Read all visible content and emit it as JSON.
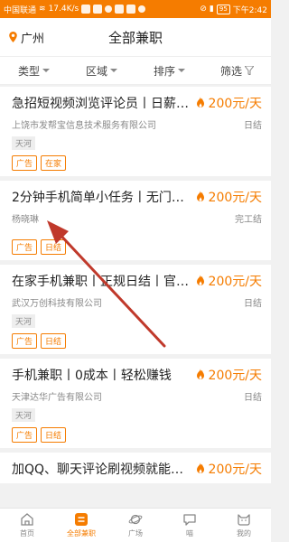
{
  "statusbar": {
    "carrier": "中国联通",
    "speed": "17.4K/s",
    "battery": "95",
    "time": "下午2:42"
  },
  "header": {
    "city": "广州",
    "title": "全部兼职"
  },
  "filters": [
    {
      "label": "类型"
    },
    {
      "label": "区域"
    },
    {
      "label": "排序"
    },
    {
      "label": "筛选"
    }
  ],
  "jobs": [
    {
      "title": "急招短视频浏览评论员丨日薪20...",
      "price": "200元/天",
      "company": "上饶市发帮宝信息技术服务有限公司",
      "settle": "日结",
      "location": "天河",
      "tags": [
        "广告",
        "在家"
      ]
    },
    {
      "title": "2分钟手机简单小任务丨无门槛...",
      "price": "200元/天",
      "company": "杨晓琳",
      "settle": "完工结",
      "location": "",
      "tags": [
        "广告",
        "日结"
      ]
    },
    {
      "title": "在家手机兼职丨正规日结丨官方...",
      "price": "200元/天",
      "company": "武汉万创科技有限公司",
      "settle": "日结",
      "location": "天河",
      "tags": [
        "广告",
        "日结"
      ]
    },
    {
      "title": "手机兼职丨0成本丨轻松赚钱",
      "price": "200元/天",
      "company": "天津达华广告有限公司",
      "settle": "日结",
      "location": "天河",
      "tags": [
        "广告",
        "日结"
      ]
    },
    {
      "title": "加QQ、聊天评论刷视频就能挣...",
      "price": "200元/天",
      "company": "",
      "settle": "",
      "location": "",
      "tags": []
    }
  ],
  "tabs": [
    {
      "label": "首页",
      "icon": "home-icon"
    },
    {
      "label": "全部兼职",
      "icon": "list-icon",
      "active": true
    },
    {
      "label": "广场",
      "icon": "planet-icon"
    },
    {
      "label": "喵",
      "icon": "chat-icon"
    },
    {
      "label": "我的",
      "icon": "cat-icon"
    }
  ],
  "colors": {
    "accent": "#f57c00",
    "arrow": "#c0392b"
  }
}
